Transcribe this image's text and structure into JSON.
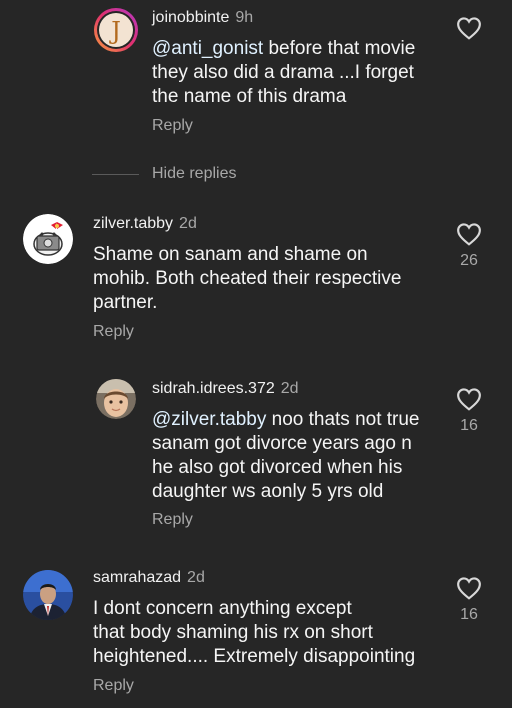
{
  "comments": [
    {
      "username": "joinobbinte",
      "time": "9h",
      "mention": "@anti_gonist",
      "text": [
        " before that movie",
        "they also did a drama ...I forget",
        "the name of this drama"
      ],
      "reply_label": "Reply",
      "likes": ""
    },
    {
      "username": "zilver.tabby",
      "time": "2d",
      "mention": "",
      "text": [
        "Shame on sanam and shame on",
        "mohib. Both cheated their respective",
        "partner."
      ],
      "reply_label": "Reply",
      "likes": "26"
    },
    {
      "username": "sidrah.idrees.372",
      "time": "2d",
      "mention": "@zilver.tabby",
      "text": [
        " noo thats not true",
        "sanam got divorce years ago n",
        "he also got divorced when his",
        "daughter ws aonly 5 yrs old"
      ],
      "reply_label": "Reply",
      "likes": "16"
    },
    {
      "username": "samrahazad",
      "time": "2d",
      "mention": "",
      "text": [
        "I dont concern anything except",
        "that body shaming his rx on short",
        "heightened.... Extremely disappointing"
      ],
      "reply_label": "Reply",
      "likes": "16"
    }
  ],
  "hide_replies_label": "Hide replies",
  "colors": {
    "background": "#262626",
    "text": "#f5f5f5",
    "secondary": "#a8a8a8",
    "mention": "#e0f1ff"
  }
}
